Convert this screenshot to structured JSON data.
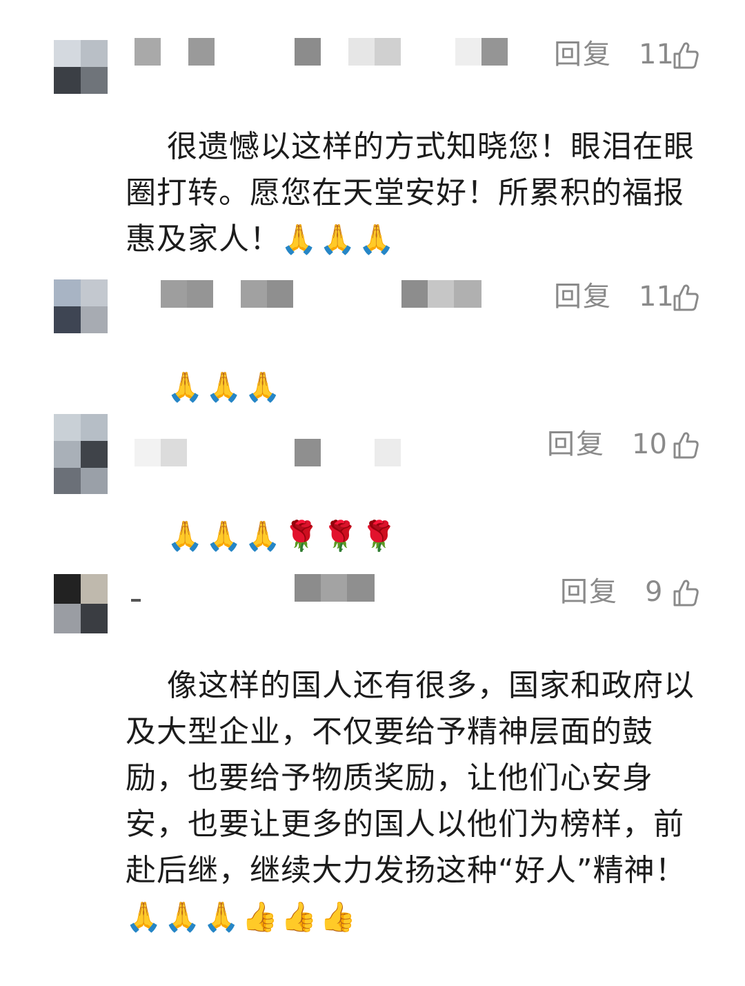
{
  "comments": [
    {
      "reply_label": "回复",
      "likes": "11",
      "thumb_icon": "thumbs-up-outline-icon",
      "text": "很遗憾以这样的方式知晓您！眼泪在眼圈打转。愿您在天堂安好！所累积的福报惠及家人！",
      "emoji": "🙏🙏🙏"
    },
    {
      "reply_label": "回复",
      "likes": "11",
      "thumb_icon": "thumbs-up-outline-icon",
      "text": "",
      "emoji": "🙏🙏🙏"
    },
    {
      "reply_label": "回复",
      "likes": "10",
      "thumb_icon": "thumbs-up-outline-icon",
      "text": "",
      "emoji": "🙏🙏🙏🌹🌹🌹"
    },
    {
      "reply_label": "回复",
      "likes": "9",
      "thumb_icon": "thumbs-up-outline-icon",
      "text": "像这样的国人还有很多，国家和政府以及大型企业，不仅要给予精神层面的鼓励，也要给予物质奖励，让他们心安身安，也要让更多的国人以他们为榜样，前赴后继，继续大力发扬这种“好人”精神！",
      "emoji": "🙏🙏🙏👍👍👍"
    }
  ],
  "colors": {
    "meta_gray": "#8a8a8a",
    "text": "#1c1c1c",
    "background": "#ffffff"
  }
}
